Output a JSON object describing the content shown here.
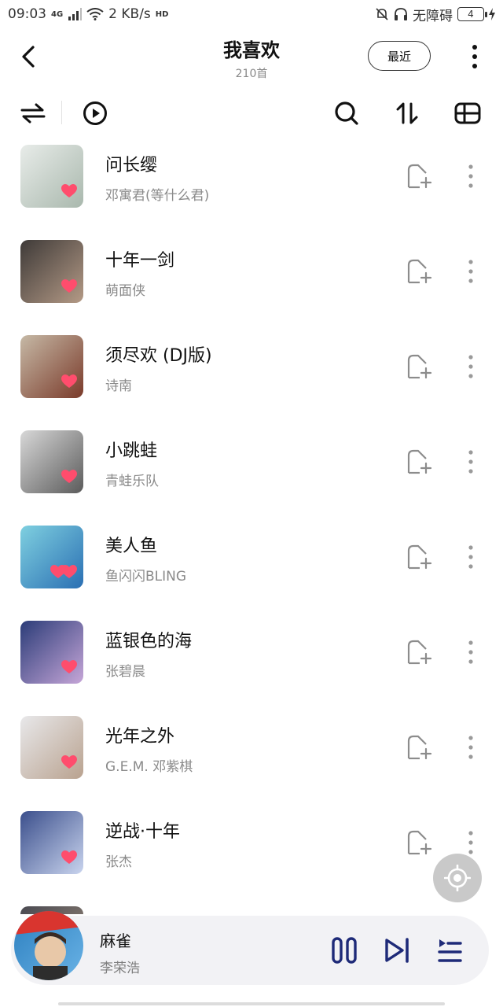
{
  "status_bar": {
    "time": "09:03",
    "network": "4G",
    "speed": "2 KB/s",
    "hd": "HD",
    "accessibility": "无障碍",
    "battery": "4"
  },
  "header": {
    "title": "我喜欢",
    "count": "210首",
    "recent_label": "最近"
  },
  "toolbar": {
    "icons": [
      "shuffle-icon",
      "play-icon",
      "search-icon",
      "sort-icon",
      "layout-icon"
    ]
  },
  "songs": [
    {
      "name": "问长缨",
      "artist": "邓寓君(等什么君)",
      "hearts": 1,
      "cover": [
        "#e8ece9",
        "#a9b8ad"
      ]
    },
    {
      "name": "十年一剑",
      "artist": "萌面侠",
      "hearts": 1,
      "cover": [
        "#3e3a38",
        "#b49a86"
      ]
    },
    {
      "name": "须尽欢 (DJ版)",
      "artist": "诗南",
      "hearts": 1,
      "cover": [
        "#c6b9a6",
        "#7a3a2a"
      ]
    },
    {
      "name": "小跳蛙",
      "artist": "青蛙乐队",
      "hearts": 1,
      "cover": [
        "#d8d8d8",
        "#5b5b5b"
      ]
    },
    {
      "name": "美人鱼",
      "artist": "鱼闪闪BLING",
      "hearts": 2,
      "cover": [
        "#7fd0e0",
        "#2a6fb3"
      ]
    },
    {
      "name": "蓝银色的海",
      "artist": "张碧晨",
      "hearts": 1,
      "cover": [
        "#2b3c78",
        "#c6a6d8"
      ]
    },
    {
      "name": "光年之外",
      "artist": "G.E.M. 邓紫棋",
      "hearts": 1,
      "cover": [
        "#e8e8ea",
        "#b9a28f"
      ]
    },
    {
      "name": "逆战·十年",
      "artist": "张杰",
      "hearts": 1,
      "cover": [
        "#3b4f8c",
        "#c9d4ee"
      ]
    }
  ],
  "player": {
    "song": "麻雀",
    "artist": "李荣浩"
  },
  "colors": {
    "heart": "#ff4d6d",
    "accent_text": "#111111",
    "secondary_text": "#8a8a8a",
    "player_bg": "#f2f2f5",
    "icon_blue": "#1e2a78"
  }
}
